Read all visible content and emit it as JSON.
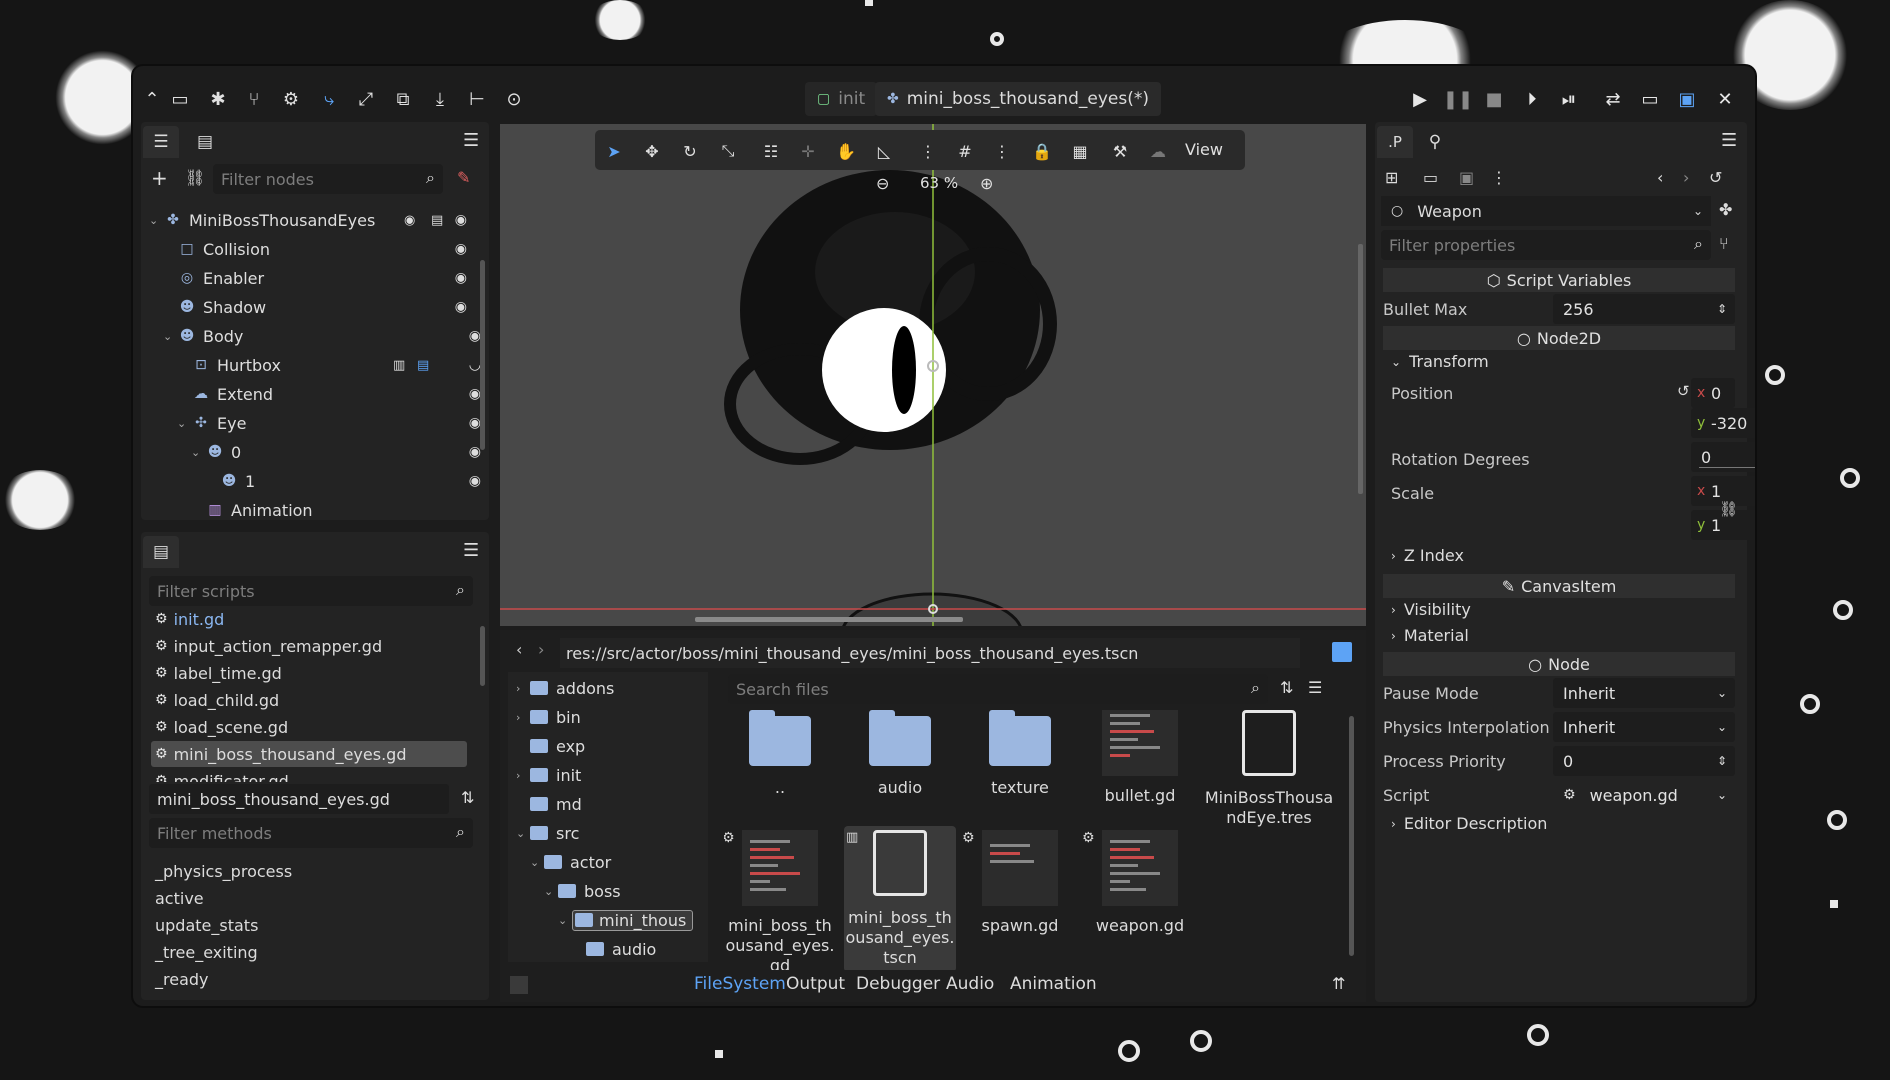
{
  "title_bar": {
    "tabs": [
      {
        "label": "init",
        "active": false
      },
      {
        "label": "mini_boss_thousand_eyes(*)",
        "active": true
      }
    ]
  },
  "scene_panel": {
    "filter_placeholder": "Filter nodes",
    "nodes": [
      {
        "label": "MiniBossThousandEyes"
      },
      {
        "label": "Collision"
      },
      {
        "label": "Enabler"
      },
      {
        "label": "Shadow"
      },
      {
        "label": "Body"
      },
      {
        "label": "Hurtbox"
      },
      {
        "label": "Extend"
      },
      {
        "label": "Eye"
      },
      {
        "label": "0"
      },
      {
        "label": "1"
      },
      {
        "label": "Animation"
      }
    ]
  },
  "script_panel": {
    "filter_placeholder": "Filter scripts",
    "scripts": [
      "init.gd",
      "input_action_remapper.gd",
      "label_time.gd",
      "load_child.gd",
      "load_scene.gd",
      "mini_boss_thousand_eyes.gd",
      "modificator.gd"
    ],
    "selected_script": "mini_boss_thousand_eyes.gd",
    "current_file": "mini_boss_thousand_eyes.gd",
    "methods_placeholder": "Filter methods",
    "methods": [
      "_physics_process",
      "active",
      "update_stats",
      "_tree_exiting",
      "_ready"
    ]
  },
  "viewport": {
    "zoom": "63 %",
    "view_menu": "View"
  },
  "filesystem": {
    "path": "res://src/actor/boss/mini_thousand_eyes/mini_boss_thousand_eyes.tscn",
    "search_placeholder": "Search files",
    "tree": [
      "addons",
      "bin",
      "exp",
      "init",
      "md",
      "src",
      "actor",
      "boss",
      "mini_thous",
      "audio"
    ],
    "files": [
      {
        "name": "..",
        "kind": "folder"
      },
      {
        "name": "audio",
        "kind": "folder"
      },
      {
        "name": "texture",
        "kind": "folder"
      },
      {
        "name": "bullet.gd",
        "kind": "script"
      },
      {
        "name": "MiniBossThousandEye.tres",
        "kind": "resource"
      },
      {
        "name": "mini_boss_thousand_eyes.gd",
        "kind": "script"
      },
      {
        "name": "mini_boss_thousand_eyes.tscn",
        "kind": "scene"
      },
      {
        "name": "spawn.gd",
        "kind": "script"
      },
      {
        "name": "weapon.gd",
        "kind": "script"
      }
    ],
    "bottom_tabs": [
      "FileSystem",
      "Output",
      "Debugger",
      "Audio",
      "Animation"
    ]
  },
  "inspector": {
    "tab_label": ".P",
    "node_name": "Weapon",
    "filter_placeholder": "Filter properties",
    "script_variables_header": "Script Variables",
    "bullet_max_label": "Bullet Max",
    "bullet_max_value": "256",
    "node2d_header": "Node2D",
    "transform_label": "Transform",
    "position_label": "Position",
    "x_axis": "x",
    "y_axis": "y",
    "position_x": "0",
    "position_y": "-320",
    "rotation_label": "Rotation Degrees",
    "rotation_value": "0",
    "scale_label": "Scale",
    "scale_x": "1",
    "scale_y": "1",
    "z_index_label": "Z Index",
    "canvasitem_header": "CanvasItem",
    "visibility_label": "Visibility",
    "material_label": "Material",
    "node_header": "Node",
    "pause_mode_label": "Pause Mode",
    "pause_mode_value": "Inherit",
    "physics_interp_label": "Physics Interpolation",
    "physics_interp_value": "Inherit",
    "process_priority_label": "Process Priority",
    "process_priority_value": "0",
    "script_label": "Script",
    "script_value": "weapon.gd",
    "editor_desc_label": "Editor Description"
  },
  "colors": {
    "accent": "#5da3f5",
    "panel": "#232323",
    "viewport": "#484848"
  }
}
